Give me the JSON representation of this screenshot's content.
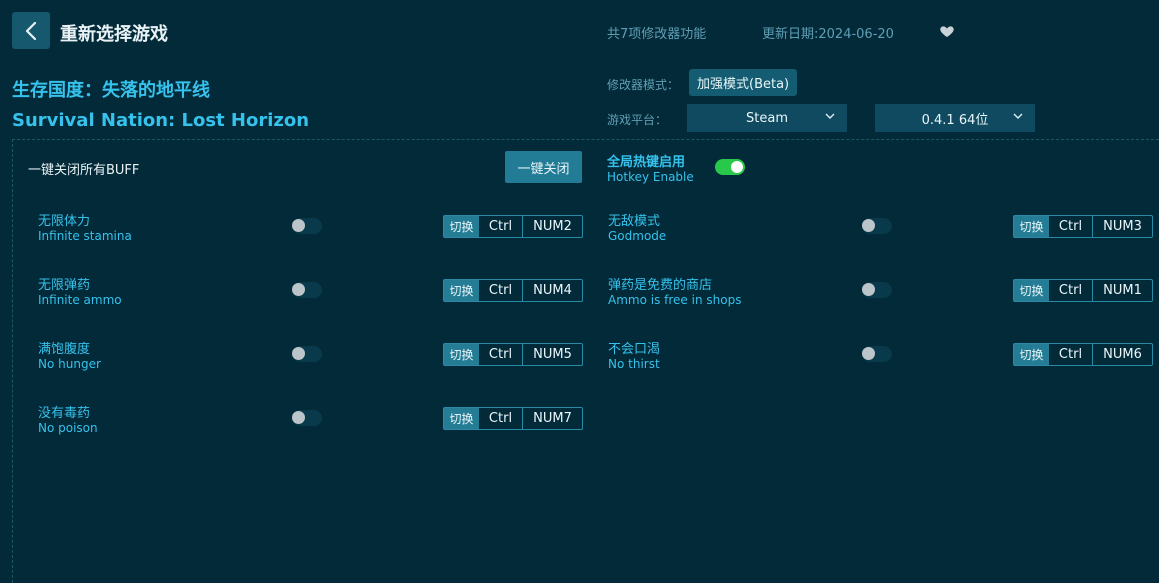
{
  "header": {
    "title": "重新选择游戏",
    "feature_count": "共7项修改器功能",
    "update_date": "更新日期:2024-06-20"
  },
  "game": {
    "title_cn": "生存国度：失落的地平线",
    "title_en": "Survival Nation: Lost Horizon"
  },
  "mode": {
    "label": "修改器模式：",
    "value": "加强模式(Beta)"
  },
  "platform": {
    "label": "游戏平台：",
    "value": "Steam",
    "version": "0.4.1 64位"
  },
  "buff": {
    "label": "一键关闭所有BUFF",
    "button": "一键关闭"
  },
  "hotkey": {
    "label_cn": "全局热键启用",
    "label_en": "Hotkey Enable",
    "enabled": true
  },
  "key_labels": {
    "switch": "切换",
    "ctrl": "Ctrl"
  },
  "cheats": [
    {
      "cn": "无限体力",
      "en": "Infinite stamina",
      "key": "NUM2",
      "on": false
    },
    {
      "cn": "无敌模式",
      "en": "Godmode",
      "key": "NUM3",
      "on": false
    },
    {
      "cn": "无限弹药",
      "en": "Infinite ammo",
      "key": "NUM4",
      "on": false
    },
    {
      "cn": "弹药是免费的商店",
      "en": "Ammo is free in shops",
      "key": "NUM1",
      "on": false
    },
    {
      "cn": "满饱腹度",
      "en": "No hunger",
      "key": "NUM5",
      "on": false
    },
    {
      "cn": "不会口渴",
      "en": "No thirst",
      "key": "NUM6",
      "on": false
    },
    {
      "cn": "没有毒药",
      "en": "No poison",
      "key": "NUM7",
      "on": false
    }
  ],
  "colors": {
    "background": "#032a39",
    "accent": "#35c2ec",
    "toggle_on": "#28c94b",
    "button": "#227c96"
  },
  "icons": {
    "back": "chevron-left-icon",
    "favorite": "heart-icon",
    "dropdown": "chevron-down-icon"
  }
}
